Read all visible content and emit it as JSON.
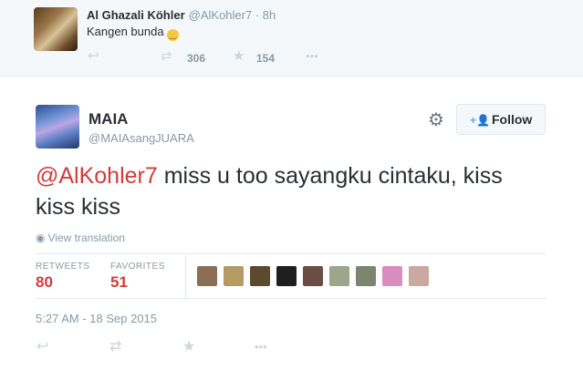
{
  "parent_tweet": {
    "name": "Al Ghazali Köhler",
    "handle": "@AlKohler7",
    "time": "· 8h",
    "text": "Kangen bunda",
    "emoji": "😅",
    "retweets": "306",
    "favorites": "154"
  },
  "tweet": {
    "name": "MAIA",
    "handle": "@MAIAsangJUARA",
    "follow_label": "Follow",
    "mention": "@AlKohler7",
    "text": " miss u too sayangku cintaku, kiss kiss kiss",
    "view_translation": "View translation",
    "retweets_label": "RETWEETS",
    "retweets": "80",
    "favorites_label": "FAVORITES",
    "favorites": "51",
    "timestamp": "5:27 AM - 18 Sep 2015"
  },
  "icons": {
    "reply": "reply-icon",
    "retweet": "retweet-icon",
    "favorite": "star-icon",
    "more": "more-icon",
    "settings": "gear-icon",
    "follow": "follow-user-icon",
    "globe": "globe-icon"
  },
  "colors": {
    "accent": "#d43a3a",
    "muted": "#8899a6",
    "link_blue": "#55acee",
    "parent_bg": "#f5f8fa"
  }
}
